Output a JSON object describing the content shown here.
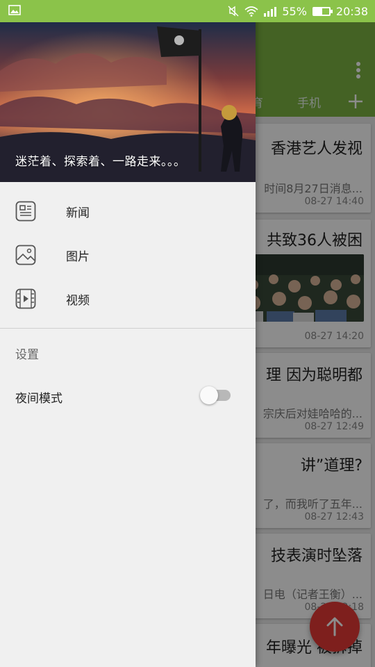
{
  "status_bar": {
    "battery_percent": "55%",
    "battery_level": 0.55,
    "time": "20:38",
    "icons": [
      "image-icon",
      "mute-icon",
      "wifi-icon",
      "signal-icon",
      "signal-icon",
      "battery-icon"
    ]
  },
  "toolbar": {
    "tabs": [
      "育",
      "手机"
    ],
    "more_icon": "more-vert-icon",
    "add_icon": "plus-icon"
  },
  "news_cards": [
    {
      "title": "香港艺人发视",
      "desc": "时间8月27日消息...",
      "time": "08-27 14:40"
    },
    {
      "title": "共致36人被困",
      "desc": "",
      "time": "08-27 14:20",
      "has_image": true
    },
    {
      "title": "理 因为聪明都",
      "desc": "宗庆后对娃哈哈的...",
      "time": "08-27 12:49"
    },
    {
      "title": "讲”道理?",
      "desc": "了，而我听了五年...",
      "time": "08-27 12:43"
    },
    {
      "title": "技表演时坠落",
      "desc": "日电（记者王衡）...",
      "time": "08-27 12:18"
    },
    {
      "title": "年曝光 被拆掉",
      "desc": "",
      "time": ""
    }
  ],
  "fab": {
    "icon": "arrow-up-icon"
  },
  "drawer": {
    "header_text": "迷茫着、探索着、一路走来。。。",
    "menu_items": [
      {
        "label": "新闻",
        "icon": "news-icon"
      },
      {
        "label": "图片",
        "icon": "image-icon"
      },
      {
        "label": "视频",
        "icon": "video-icon"
      }
    ],
    "settings_label": "设置",
    "night_mode_label": "夜间模式",
    "night_mode_enabled": false
  },
  "colors": {
    "status_bar": "#8bc34a",
    "toolbar": "#7cb342",
    "fab": "#e53935",
    "drawer_bg": "#f0f0f0"
  }
}
